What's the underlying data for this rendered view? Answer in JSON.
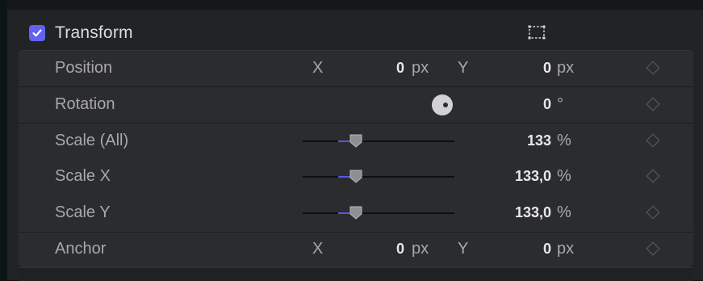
{
  "section": {
    "title": "Transform",
    "enabled": true,
    "onscreen_icon": "onscreen-controls-icon"
  },
  "rows": {
    "position": {
      "label": "Position",
      "x_label": "X",
      "x_value": "0",
      "x_unit": "px",
      "y_label": "Y",
      "y_value": "0",
      "y_unit": "px"
    },
    "rotation": {
      "label": "Rotation",
      "value": "0",
      "unit": "°"
    },
    "scale_all": {
      "label": "Scale (All)",
      "value": "133",
      "unit": "%",
      "slider_fraction": 0.33
    },
    "scale_x": {
      "label": "Scale X",
      "value": "133,0",
      "unit": "%",
      "slider_fraction": 0.33
    },
    "scale_y": {
      "label": "Scale Y",
      "value": "133,0",
      "unit": "%",
      "slider_fraction": 0.33
    },
    "anchor": {
      "label": "Anchor",
      "x_label": "X",
      "x_value": "0",
      "x_unit": "px",
      "y_label": "Y",
      "y_value": "0",
      "y_unit": "px"
    }
  },
  "colors": {
    "accent": "#6361f2",
    "slider_fill": "#5856e6"
  }
}
